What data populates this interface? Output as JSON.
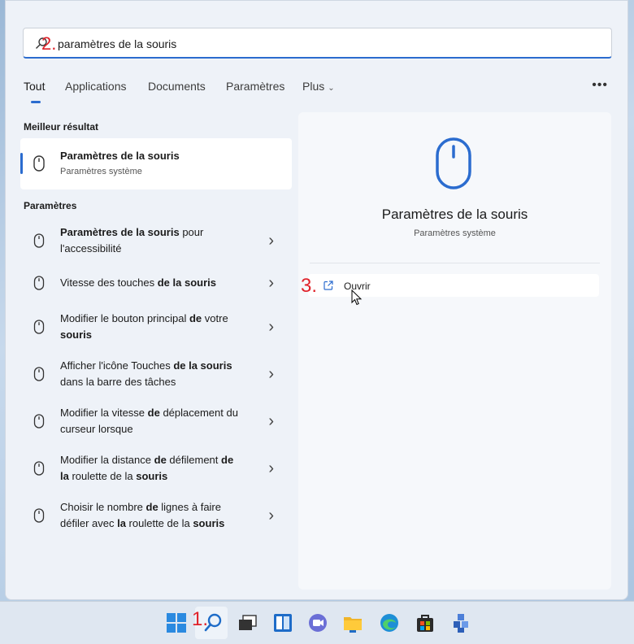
{
  "search": {
    "value": "paramètres de la souris",
    "annotation": "2."
  },
  "tabs": [
    {
      "label": "Tout",
      "active": true
    },
    {
      "label": "Applications"
    },
    {
      "label": "Documents"
    },
    {
      "label": "Paramètres"
    },
    {
      "label": "Plus"
    }
  ],
  "more_menu_icon": "ellipsis-icon",
  "best_match": {
    "section_label": "Meilleur résultat",
    "title": "Paramètres de la souris",
    "subtitle": "Paramètres système",
    "icon": "mouse-icon"
  },
  "settings_section": {
    "label": "Paramètres",
    "items": [
      {
        "parts": [
          {
            "t": "Paramètres de la souris",
            "b": true
          },
          {
            "t": " pour l'accessibilité",
            "b": false
          }
        ]
      },
      {
        "parts": [
          {
            "t": "Vitesse des touches ",
            "b": false
          },
          {
            "t": "de la souris",
            "b": true
          }
        ]
      },
      {
        "parts": [
          {
            "t": "Modifier le bouton principal ",
            "b": false
          },
          {
            "t": "de",
            "b": true
          },
          {
            "t": " votre ",
            "b": false
          },
          {
            "t": "souris",
            "b": true
          }
        ]
      },
      {
        "parts": [
          {
            "t": "Afficher l'icône Touches ",
            "b": false
          },
          {
            "t": "de la souris",
            "b": true
          },
          {
            "t": " dans la barre des tâches",
            "b": false
          }
        ]
      },
      {
        "parts": [
          {
            "t": "Modifier la vitesse ",
            "b": false
          },
          {
            "t": "de",
            "b": true
          },
          {
            "t": " déplacement du curseur lorsque",
            "b": false
          }
        ]
      },
      {
        "parts": [
          {
            "t": "Modifier la distance ",
            "b": false
          },
          {
            "t": "de",
            "b": true
          },
          {
            "t": " défilement ",
            "b": false
          },
          {
            "t": "de la",
            "b": true
          },
          {
            "t": " roulette de la ",
            "b": false
          },
          {
            "t": "souris",
            "b": true
          }
        ]
      },
      {
        "parts": [
          {
            "t": "Choisir le nombre ",
            "b": false
          },
          {
            "t": "de",
            "b": true
          },
          {
            "t": " lignes à faire défiler avec ",
            "b": false
          },
          {
            "t": "la",
            "b": true
          },
          {
            "t": " roulette de la ",
            "b": false
          },
          {
            "t": "souris",
            "b": true
          }
        ]
      }
    ]
  },
  "preview": {
    "title": "Paramètres de la souris",
    "subtitle": "Paramètres système",
    "open_label": "Ouvrir",
    "open_annotation": "3."
  },
  "taskbar": {
    "annotation": "1.",
    "icons": [
      "start-icon",
      "search-icon",
      "task-view-icon",
      "widgets-icon",
      "chat-icon",
      "file-explorer-icon",
      "edge-icon",
      "store-icon",
      "app-icon"
    ]
  },
  "colors": {
    "accent": "#2b6ccf",
    "annotation": "#e0222a"
  }
}
